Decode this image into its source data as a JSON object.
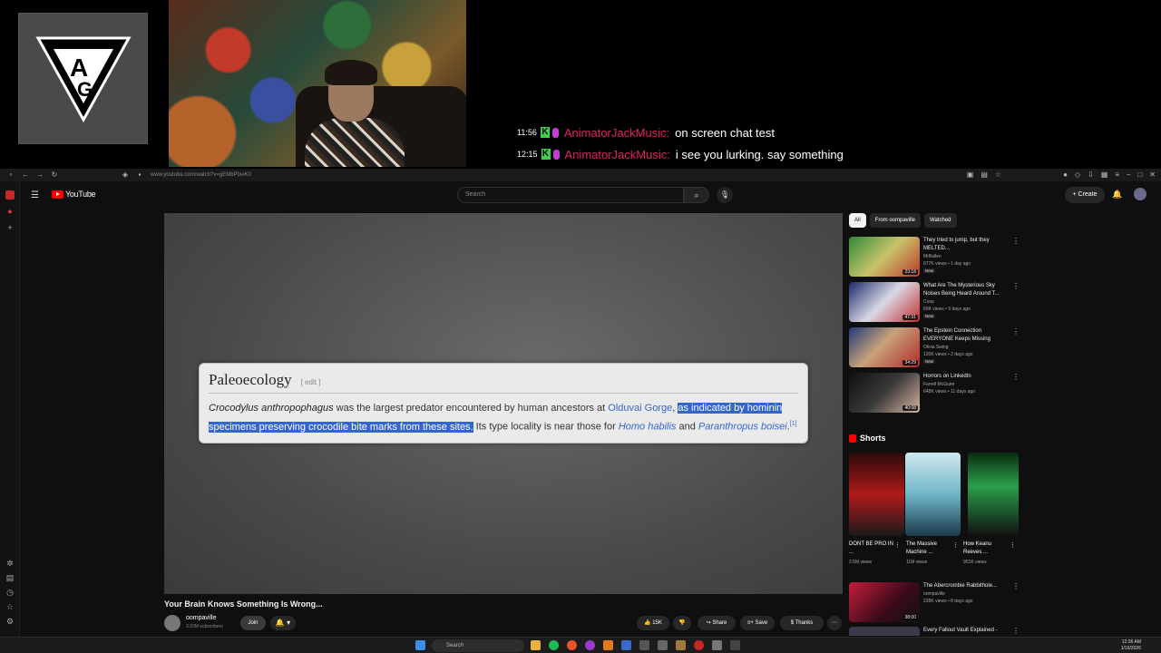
{
  "stream": {
    "chat": [
      {
        "time": "11:56",
        "badge": "K",
        "user": "AnimatorJackMusic:",
        "message": "on screen chat test"
      },
      {
        "time": "12:15",
        "badge": "K",
        "user": "AnimatorJackMusic:",
        "message": "i see you lurking. say something"
      }
    ],
    "logo_letters": [
      "A",
      "G"
    ]
  },
  "browser": {
    "url": "www.youtube.com/watch?v=gEMbPfxeK0"
  },
  "youtube": {
    "logo_text": "YouTube",
    "search_placeholder": "Search",
    "create_label": "Create",
    "video": {
      "title": "Your Brain Knows Something Is Wrong...",
      "channel": "oompaville",
      "subscribers": "3.93M subscribers",
      "join_label": "Join",
      "bell_label": "🔔 ▾",
      "likes": "15K",
      "share_label": "Share",
      "save_label": "Save",
      "thanks_label": "Thanks"
    },
    "wiki_card": {
      "title": "Paleoecology",
      "edit_label": "[ edit ]",
      "species": "Crocodylus anthropophagus",
      "text_1": " was the largest predator encountered by human ancestors at ",
      "link_gorge": "Olduvai Gorge",
      "comma": ", ",
      "highlight": "as indicated by hominin specimens preserving crocodile bite marks from these sites.",
      "text_2": " Its type locality is near those for ",
      "link_homo": "Homo habilis",
      "and": " and ",
      "link_paranthropus": "Paranthropus boisei",
      "period": ".",
      "ref": "[1]"
    },
    "chips": [
      "All",
      "From oompaville",
      "Watched"
    ],
    "recommendations": [
      {
        "title": "They tried to jump, but they MELTED...",
        "channel": "MrBallen",
        "meta": "677K views • 1 day ago",
        "duration": "23:18",
        "badge": "New"
      },
      {
        "title": "What Are The Mysterious Sky Noises Being Heard Around T...",
        "channel": "Coop",
        "meta": "69K views • 5 days ago",
        "duration": "47:31",
        "badge": "New"
      },
      {
        "title": "The Epstein Connection EVERYONE Keeps Missing",
        "channel": "Olivia Swing",
        "meta": "120K views • 2 days ago",
        "duration": "34:29",
        "badge": "New"
      },
      {
        "title": "Horrors on LinkedIn",
        "channel": "Farrell McGuire",
        "meta": "648K views • 11 days ago",
        "duration": "40:08",
        "badge": ""
      }
    ],
    "shorts_label": "Shorts",
    "shorts": [
      {
        "title": "DONT BE PRO IN ...",
        "views": "2.6M views"
      },
      {
        "title": "The Massive Machine ...",
        "views": "11M views"
      },
      {
        "title": "How Keanu Reeves ...",
        "views": "951K views"
      }
    ],
    "more_recs": [
      {
        "title": "The Abercrombie Rabbithole...",
        "channel": "oompaville",
        "meta": "228K views • 8 days ago",
        "duration": "38:00"
      },
      {
        "title": "Every Fallout Vault Explained -",
        "channel": "",
        "meta": "",
        "duration": ""
      }
    ]
  },
  "taskbar": {
    "search_label": "Search",
    "time": "12:36 AM",
    "date": "1/16/2026"
  }
}
